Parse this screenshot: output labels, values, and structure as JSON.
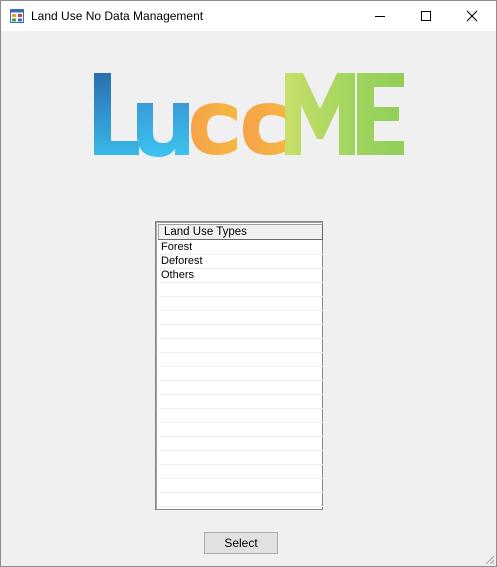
{
  "window": {
    "title": "Land Use No Data Management",
    "icon": "app-form-icon",
    "controls": [
      "minimize-icon",
      "maximize-icon",
      "close-icon"
    ]
  },
  "logo": {
    "text": "LuccME",
    "colors": {
      "L": "#2f86c8",
      "u": "#3ab7e8",
      "cc": "#f2a43c",
      "M": "#b7d96a",
      "E": "#8fcf5a"
    }
  },
  "listview": {
    "header": "Land Use Types",
    "items": [
      "Forest",
      "Deforest",
      "Others"
    ]
  },
  "buttons": {
    "select_label": "Select"
  }
}
